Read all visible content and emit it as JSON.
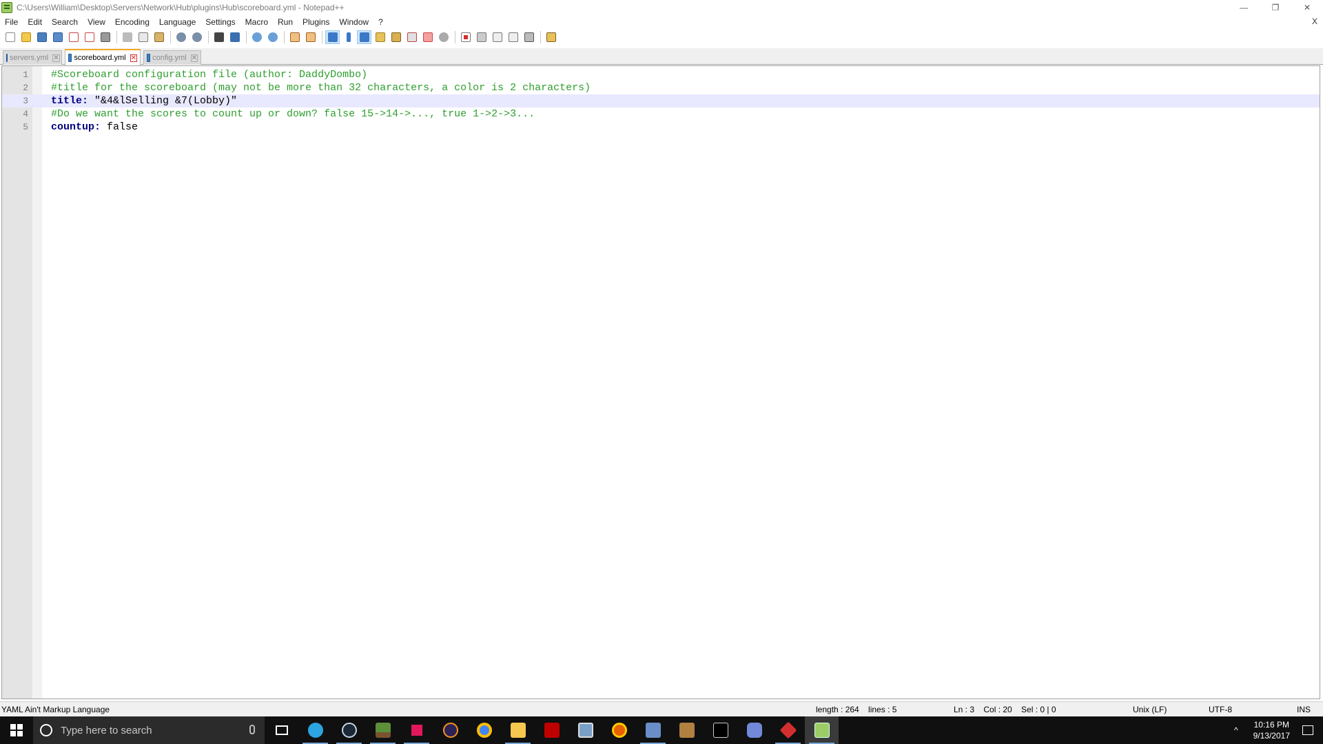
{
  "window": {
    "title": "C:\\Users\\William\\Desktop\\Servers\\Network\\Hub\\plugins\\Hub\\scoreboard.yml - Notepad++",
    "minimize": "—",
    "restore": "❐",
    "close": "✕"
  },
  "menu": {
    "items": [
      "File",
      "Edit",
      "Search",
      "View",
      "Encoding",
      "Language",
      "Settings",
      "Macro",
      "Run",
      "Plugins",
      "Window",
      "?"
    ],
    "close_doc": "X"
  },
  "tabs": [
    {
      "label": "servers.yml",
      "active": false
    },
    {
      "label": "scoreboard.yml",
      "active": true
    },
    {
      "label": "config.yml",
      "active": false
    }
  ],
  "editor": {
    "current_line": 3,
    "lines": [
      {
        "num": "1",
        "type": "comment",
        "text": "#Scoreboard configuration file (author: DaddyDombo)"
      },
      {
        "num": "2",
        "type": "comment",
        "text": "#title for the scoreboard (may not be more than 32 characters, a color is 2 characters)"
      },
      {
        "num": "3",
        "type": "pair",
        "key": "title:",
        "value": " \"&4&lSelling &7(Lobby)\""
      },
      {
        "num": "4",
        "type": "comment",
        "text": "#Do we want the scores to count up or down? false 15->14->..., true 1->2->3..."
      },
      {
        "num": "5",
        "type": "pair",
        "key": "countup:",
        "value": " false"
      }
    ]
  },
  "status": {
    "language": "YAML Ain't Markup Language",
    "length": "length : 264    lines : 5",
    "position": "Ln : 3    Col : 20    Sel : 0 | 0",
    "eol": "Unix (LF)",
    "encoding": "UTF-8",
    "mode": "INS"
  },
  "taskbar": {
    "search_placeholder": "Type here to search",
    "time": "10:16 PM",
    "date": "9/13/2017",
    "tray_arrow": "^"
  },
  "colors": {
    "comment": "#2e9e2e",
    "yaml_key": "#000080",
    "current_line": "#e8e8ff",
    "active_tab_accent": "#f5a623"
  }
}
